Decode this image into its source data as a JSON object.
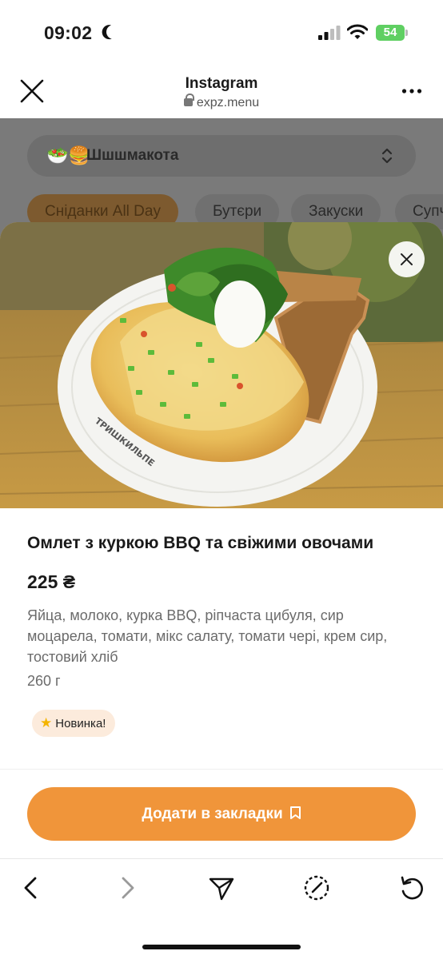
{
  "status_bar": {
    "time": "09:02",
    "battery": "54"
  },
  "browser": {
    "app_title": "Instagram",
    "url": "expz.menu"
  },
  "background_page": {
    "place_name": "Шшшмакота",
    "place_emoji": "🥗🍔",
    "categories": [
      {
        "label": "Сніданки All Day",
        "active": true
      },
      {
        "label": "Бутєри",
        "active": false
      },
      {
        "label": "Закуски",
        "active": false
      },
      {
        "label": "Супч",
        "active": false
      }
    ]
  },
  "dish": {
    "title": "Омлет з куркою BBQ та свіжими овочами",
    "price": "225 ₴",
    "description": "Яйца, молоко, курка BBQ, ріпчаста цибуля, сир моцарела,  томати, мікс салату,  томати чері, крем сир, тостовий хліб",
    "weight": "260 г",
    "badge": "Новинка!",
    "plate_text": "ТРИШКИЛЬПЕ"
  },
  "actions": {
    "bookmark_label": "Додати в закладки"
  },
  "colors": {
    "accent": "#f0953a",
    "badge_bg": "#fcebdc",
    "battery": "#5fcf62"
  }
}
